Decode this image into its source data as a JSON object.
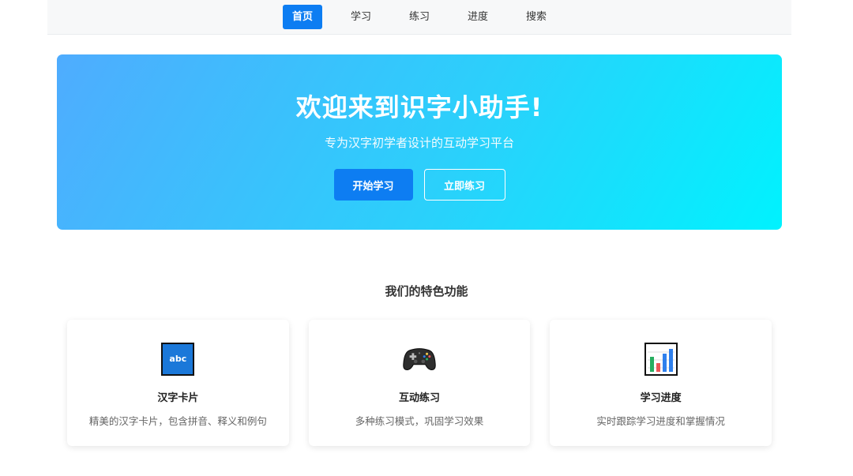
{
  "nav": {
    "items": [
      {
        "label": "首页",
        "active": true
      },
      {
        "label": "学习",
        "active": false
      },
      {
        "label": "练习",
        "active": false
      },
      {
        "label": "进度",
        "active": false
      },
      {
        "label": "搜索",
        "active": false
      }
    ]
  },
  "hero": {
    "title": "欢迎来到识字小助手!",
    "subtitle": "专为汉字初学者设计的互动学习平台",
    "primary_button": "开始学习",
    "secondary_button": "立即练习",
    "gradient_colors": [
      "#4facfe",
      "#00f2fe"
    ]
  },
  "features": {
    "title": "我们的特色功能",
    "cards": [
      {
        "icon": "abc-icon",
        "icon_text": "abc",
        "title": "汉字卡片",
        "desc": "精美的汉字卡片，包含拼音、释义和例句"
      },
      {
        "icon": "gamepad-icon",
        "title": "互动练习",
        "desc": "多种练习模式，巩固学习效果"
      },
      {
        "icon": "bar-chart-icon",
        "title": "学习进度",
        "desc": "实时跟踪学习进度和掌握情况"
      }
    ]
  },
  "colors": {
    "primary": "#0d7df2",
    "nav_bg": "#f7f8f9"
  }
}
